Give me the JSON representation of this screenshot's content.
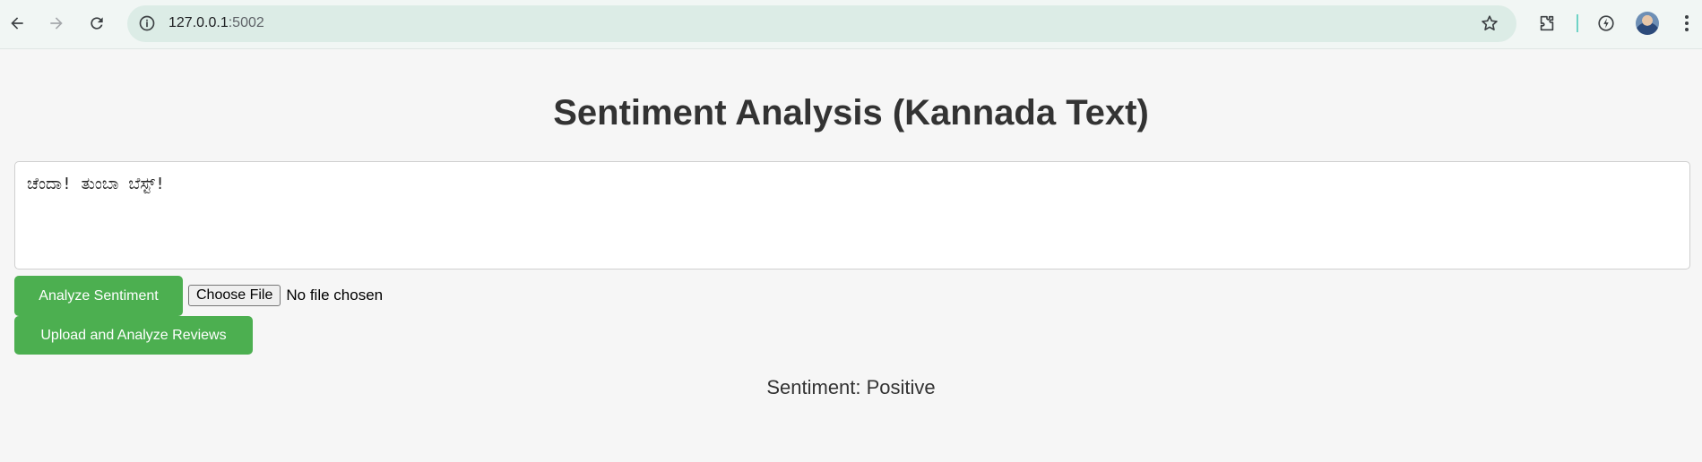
{
  "browser": {
    "url_host": "127.0.0.1",
    "url_port": ":5002",
    "icons": {
      "back": "back-arrow-icon",
      "forward": "forward-arrow-icon",
      "reload": "reload-icon",
      "site_info": "site-info-icon",
      "bookmark": "star-icon",
      "extensions": "puzzle-icon",
      "performance": "performance-icon",
      "profile": "avatar",
      "menu": "more-vert-icon"
    }
  },
  "page": {
    "title": "Sentiment Analysis (Kannada Text)",
    "textarea_value": "ಚೆಂದಾ! ತುಂಬಾ ಬೆಸ್ಟ್!",
    "analyze_button": "Analyze Sentiment",
    "file_button": "Choose File",
    "file_status": "No file chosen",
    "upload_button": "Upload and Analyze Reviews",
    "result_text": "Sentiment: Positive"
  },
  "colors": {
    "accent_green": "#4caf50",
    "page_background": "#f6f6f6",
    "omnibox_background": "#dcece6"
  }
}
